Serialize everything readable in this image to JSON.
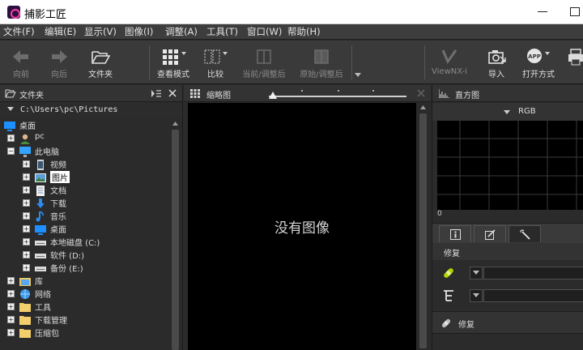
{
  "window": {
    "title": "捕影工匠"
  },
  "menu": [
    "文件(F)",
    "编辑(E)",
    "显示(V)",
    "图像(I)",
    "调整(A)",
    "工具(T)",
    "窗口(W)",
    "帮助(H)"
  ],
  "toolbar": {
    "back": "向前",
    "forward": "向后",
    "folder": "文件夹",
    "view_mode": "查看模式",
    "compare": "比较",
    "current_adjusted": "当前/调整后",
    "original_adjusted": "原始/调整后",
    "viewnx": "ViewNX-i",
    "import": "导入",
    "open_with": "打开方式"
  },
  "folder_panel": {
    "title": "文件夹",
    "path": "C:\\Users\\pc\\Pictures",
    "tree": [
      {
        "label": "桌面",
        "icon": "desktop-icon"
      },
      {
        "label": "pc",
        "icon": "user-icon"
      },
      {
        "label": "此电脑",
        "icon": "computer-icon"
      },
      {
        "label": "视频",
        "icon": "video-icon"
      },
      {
        "label": "图片",
        "icon": "pictures-icon"
      },
      {
        "label": "文档",
        "icon": "document-icon"
      },
      {
        "label": "下载",
        "icon": "download-icon"
      },
      {
        "label": "音乐",
        "icon": "music-icon"
      },
      {
        "label": "桌面",
        "icon": "desktop-icon"
      },
      {
        "label": "本地磁盘 (C:)",
        "icon": "drive-icon"
      },
      {
        "label": "软件 (D:)",
        "icon": "drive-icon"
      },
      {
        "label": "备份 (E:)",
        "icon": "drive-icon"
      },
      {
        "label": "库",
        "icon": "library-icon"
      },
      {
        "label": "网络",
        "icon": "network-icon"
      },
      {
        "label": "工具",
        "icon": "folder-icon"
      },
      {
        "label": "下载管理",
        "icon": "folder-icon"
      },
      {
        "label": "压缩包",
        "icon": "folder-icon"
      }
    ]
  },
  "thumbnail_panel": {
    "title": "缩略图",
    "empty_text": "没有图像"
  },
  "histogram_panel": {
    "title": "直方图",
    "channel": "RGB",
    "axis_zero": "0"
  },
  "adjust_panel": {
    "section_title": "修复",
    "footer_label": "修复"
  },
  "colors": {
    "accent": "#1e8fff",
    "panel_bg": "#2b2b2b",
    "canvas_bg": "#000000"
  }
}
